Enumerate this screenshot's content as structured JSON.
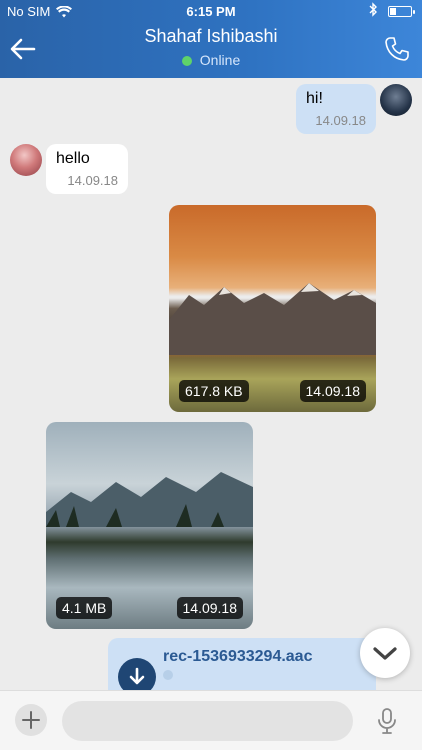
{
  "status_bar": {
    "carrier": "No SIM",
    "time": "6:15 PM"
  },
  "header": {
    "contact_name": "Shahaf Ishibashi",
    "presence": "Online"
  },
  "messages": {
    "outgoing_text": {
      "text": "hi!",
      "timestamp": "14.09.18"
    },
    "incoming_text": {
      "text": "hello",
      "timestamp": "14.09.18"
    },
    "photo_1": {
      "size": "617.8 KB",
      "timestamp": "14.09.18"
    },
    "photo_2": {
      "size": "4.1 MB",
      "timestamp": "14.09.18"
    },
    "audio": {
      "filename": "rec-1536933294.aac"
    }
  },
  "composer": {
    "placeholder": ""
  },
  "colors": {
    "header": "#2f73c2",
    "outgoing_bubble": "#cde0f5",
    "online": "#5fd36a"
  }
}
